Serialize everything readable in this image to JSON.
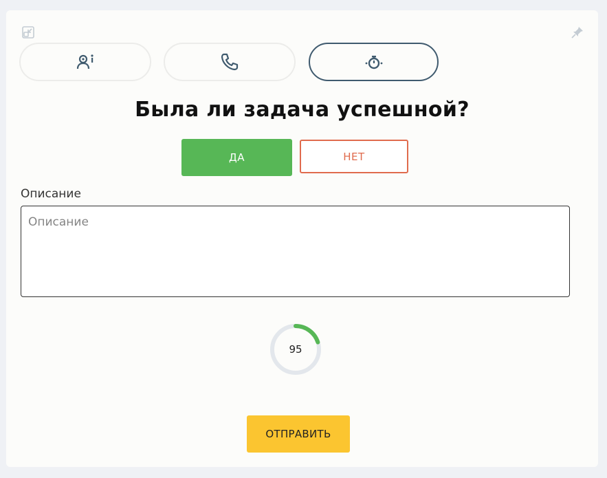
{
  "icons": {
    "collapse": "collapse-icon",
    "pin": "pin-icon",
    "tabs": [
      "user-info-icon",
      "phone-icon",
      "stopwatch-icon"
    ]
  },
  "tabs": [
    {
      "icon": "user-info-icon",
      "active": false
    },
    {
      "icon": "phone-icon",
      "active": false
    },
    {
      "icon": "stopwatch-icon",
      "active": true
    }
  ],
  "question": "Была ли задача успешной?",
  "answer": {
    "yes_label": "ДА",
    "no_label": "НЕТ"
  },
  "description": {
    "label": "Описание",
    "placeholder": "Описание",
    "value": ""
  },
  "timer": {
    "value": "95",
    "progress_fraction": 0.2
  },
  "submit_label": "ОТПРАВИТЬ",
  "colors": {
    "yes": "#57b756",
    "no": "#e06b4d",
    "submit": "#fbc530",
    "active_tab_border": "#3f5a6e",
    "timer_track": "#e3e7ec",
    "timer_progress": "#57b756"
  }
}
